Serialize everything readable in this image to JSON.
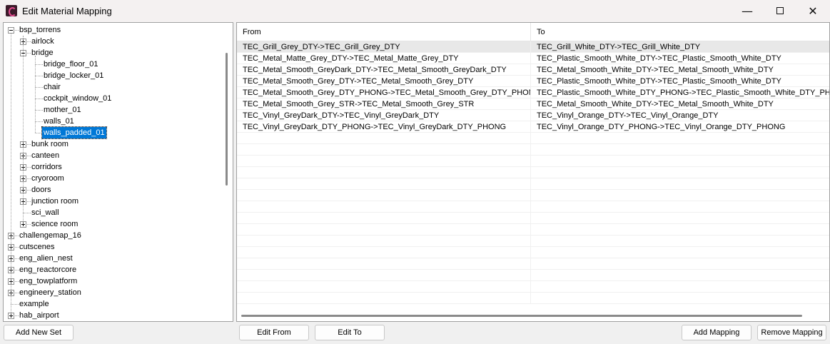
{
  "window": {
    "title": "Edit Material Mapping",
    "controls": {
      "minimize": "—",
      "close": "✕"
    }
  },
  "tree": {
    "items": [
      {
        "label": "bsp_torrens",
        "depth": 0,
        "toggle": "minus"
      },
      {
        "label": "airlock",
        "depth": 1,
        "toggle": "plus"
      },
      {
        "label": "bridge",
        "depth": 1,
        "toggle": "minus"
      },
      {
        "label": "bridge_floor_01",
        "depth": 2,
        "toggle": "none"
      },
      {
        "label": "bridge_locker_01",
        "depth": 2,
        "toggle": "none"
      },
      {
        "label": "chair",
        "depth": 2,
        "toggle": "none"
      },
      {
        "label": "cockpit_window_01",
        "depth": 2,
        "toggle": "none"
      },
      {
        "label": "mother_01",
        "depth": 2,
        "toggle": "none"
      },
      {
        "label": "walls_01",
        "depth": 2,
        "toggle": "none"
      },
      {
        "label": "walls_padded_01",
        "depth": 2,
        "toggle": "none",
        "selected": true
      },
      {
        "label": "bunk room",
        "depth": 1,
        "toggle": "plus"
      },
      {
        "label": "canteen",
        "depth": 1,
        "toggle": "plus"
      },
      {
        "label": "corridors",
        "depth": 1,
        "toggle": "plus"
      },
      {
        "label": "cryoroom",
        "depth": 1,
        "toggle": "plus"
      },
      {
        "label": "doors",
        "depth": 1,
        "toggle": "plus"
      },
      {
        "label": "junction room",
        "depth": 1,
        "toggle": "plus"
      },
      {
        "label": "sci_wall",
        "depth": 1,
        "toggle": "none"
      },
      {
        "label": "science room",
        "depth": 1,
        "toggle": "plus"
      },
      {
        "label": "challengemap_16",
        "depth": 0,
        "toggle": "plus"
      },
      {
        "label": "cutscenes",
        "depth": 0,
        "toggle": "plus"
      },
      {
        "label": "eng_alien_nest",
        "depth": 0,
        "toggle": "plus"
      },
      {
        "label": "eng_reactorcore",
        "depth": 0,
        "toggle": "plus"
      },
      {
        "label": "eng_towplatform",
        "depth": 0,
        "toggle": "plus"
      },
      {
        "label": "engineery_station",
        "depth": 0,
        "toggle": "plus"
      },
      {
        "label": "example",
        "depth": 0,
        "toggle": "none"
      },
      {
        "label": "hab_airport",
        "depth": 0,
        "toggle": "plus"
      }
    ]
  },
  "mapping_list": {
    "columns": {
      "from": "From",
      "to": "To"
    },
    "rows": [
      {
        "from": "TEC_Grill_Grey_DTY->TEC_Grill_Grey_DTY",
        "to": "TEC_Grill_White_DTY->TEC_Grill_White_DTY",
        "selected": true
      },
      {
        "from": "TEC_Metal_Matte_Grey_DTY->TEC_Metal_Matte_Grey_DTY",
        "to": "TEC_Plastic_Smooth_White_DTY->TEC_Plastic_Smooth_White_DTY"
      },
      {
        "from": "TEC_Metal_Smooth_GreyDark_DTY->TEC_Metal_Smooth_GreyDark_DTY",
        "to": "TEC_Metal_Smooth_White_DTY->TEC_Metal_Smooth_White_DTY"
      },
      {
        "from": "TEC_Metal_Smooth_Grey_DTY->TEC_Metal_Smooth_Grey_DTY",
        "to": "TEC_Plastic_Smooth_White_DTY->TEC_Plastic_Smooth_White_DTY"
      },
      {
        "from": "TEC_Metal_Smooth_Grey_DTY_PHONG->TEC_Metal_Smooth_Grey_DTY_PHONG",
        "to": "TEC_Plastic_Smooth_White_DTY_PHONG->TEC_Plastic_Smooth_White_DTY_PHONG"
      },
      {
        "from": "TEC_Metal_Smooth_Grey_STR->TEC_Metal_Smooth_Grey_STR",
        "to": "TEC_Metal_Smooth_White_DTY->TEC_Metal_Smooth_White_DTY"
      },
      {
        "from": "TEC_Vinyl_GreyDark_DTY->TEC_Vinyl_GreyDark_DTY",
        "to": "TEC_Vinyl_Orange_DTY->TEC_Vinyl_Orange_DTY"
      },
      {
        "from": "TEC_Vinyl_GreyDark_DTY_PHONG->TEC_Vinyl_GreyDark_DTY_PHONG",
        "to": "TEC_Vinyl_Orange_DTY_PHONG->TEC_Vinyl_Orange_DTY_PHONG"
      }
    ]
  },
  "buttons": {
    "add_new_set": "Add New Set",
    "edit_from": "Edit From",
    "edit_to": "Edit To",
    "add_mapping": "Add Mapping",
    "remove_mapping": "Remove Mapping"
  },
  "colors": {
    "selection": "#0078d7",
    "row_highlight": "#e8e8e8",
    "window_bg": "#f0f0f0"
  }
}
